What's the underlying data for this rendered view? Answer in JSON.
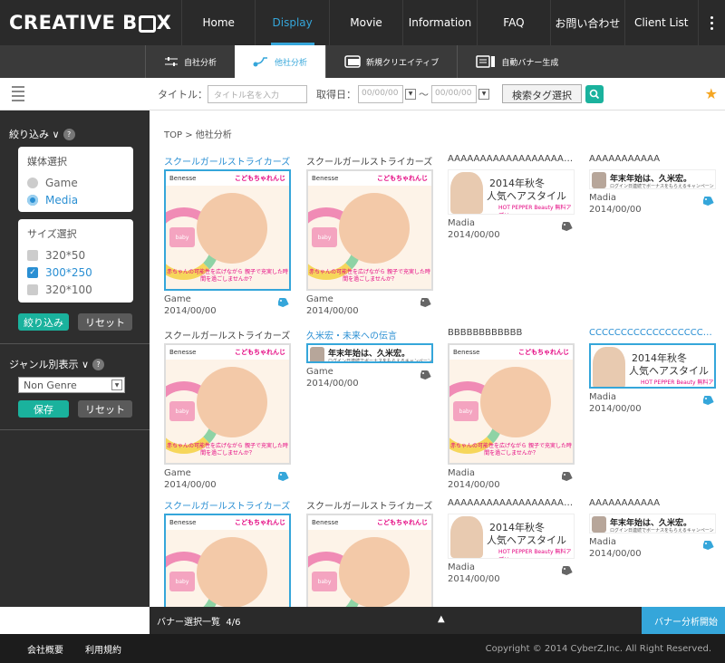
{
  "app": {
    "logo_text_1": "CREATIVE B",
    "logo_text_2": "X"
  },
  "nav": [
    {
      "label": "Home",
      "active": false
    },
    {
      "label": "Display",
      "active": true
    },
    {
      "label": "Movie",
      "active": false
    },
    {
      "label": "Information",
      "active": false
    },
    {
      "label": "FAQ",
      "active": false
    },
    {
      "label": "お問い合わせ",
      "active": false
    },
    {
      "label": "Client List",
      "active": false
    }
  ],
  "subnav": [
    {
      "label": "自社分析",
      "icon": "sliders-icon",
      "active": false
    },
    {
      "label": "他社分析",
      "icon": "analysis-icon",
      "active": true
    },
    {
      "label": "新規クリエイティブ",
      "icon": "creative-icon",
      "active": false
    },
    {
      "label": "自動バナー生成",
      "icon": "banner-icon",
      "active": false
    }
  ],
  "toolbar": {
    "title_label": "タイトル：",
    "title_placeholder": "タイトル名を入力",
    "date_label": "取得日：",
    "date_from": "00/00/00",
    "date_to": "00/00/00",
    "tilde": "～",
    "tag_button": "検索タグ選択"
  },
  "sidebar": {
    "filter_label": "絞り込み ∨",
    "media_title": "媒体選択",
    "media_options": [
      {
        "label": "Game",
        "checked": false
      },
      {
        "label": "Media",
        "checked": true
      }
    ],
    "size_title": "サイズ選択",
    "size_options": [
      {
        "label": "320*50",
        "checked": false
      },
      {
        "label": "300*250",
        "checked": true
      },
      {
        "label": "320*100",
        "checked": false
      }
    ],
    "apply_button": "絞り込み",
    "reset_button": "リセット",
    "genre_label": "ジャンル別表示 ∨",
    "genre_value": "Non Genre",
    "save_button": "保存",
    "reset_button_2": "リセット"
  },
  "breadcrumb": "TOP > 他社分析",
  "banner_text": {
    "benesse": "Benesse",
    "kodomo": "こどもちゃれんじ",
    "baby": "baby",
    "caption": "赤ちゃんの可能性を広げながら\n親子で充実した時間を過ごしませんか？",
    "autumn_line1": "2014年秋冬",
    "autumn_line2": "人気ヘアスタイル",
    "autumn_small": "HOT PEPPER Beauty 無料アプリ",
    "newyear_title": "年末年始は、久米宏。",
    "newyear_sub": "ログイン日連続でボーナスをもらえるキャンペーン"
  },
  "cards": [
    {
      "title": "スクールガールストライカーズ",
      "title_blue": true,
      "meta1": "Game",
      "meta2": "2014/00/00",
      "tag": "blue",
      "type": "sq",
      "selected": true
    },
    {
      "title": "スクールガールストライカーズ",
      "title_blue": false,
      "meta1": "Game",
      "meta2": "2014/00/00",
      "tag": "grey",
      "type": "sq",
      "selected": false
    },
    {
      "title": "AAAAAAAAAAAAAAAAAAAA···",
      "title_blue": false,
      "meta1": "Madia",
      "meta2": "2014/00/00",
      "tag": "grey",
      "type": "md",
      "selected": false
    },
    {
      "title": "AAAAAAAAAAA",
      "title_blue": false,
      "meta1": "Madia",
      "meta2": "2014/00/00",
      "tag": "blue",
      "type": "wd",
      "selected": false
    },
    {
      "title": "スクールガールストライカーズ",
      "title_blue": false,
      "meta1": "Game",
      "meta2": "2014/00/00",
      "tag": "blue",
      "type": "sq",
      "selected": false
    },
    {
      "title": "久米宏・未来への伝言",
      "title_blue": true,
      "meta1": "Game",
      "meta2": "2014/00/00",
      "tag": "grey",
      "type": "wd",
      "selected": true
    },
    {
      "title": "BBBBBBBBBBBB",
      "title_blue": false,
      "meta1": "Madia",
      "meta2": "2014/00/00",
      "tag": "grey",
      "type": "sq",
      "selected": false
    },
    {
      "title": "CCCCCCCCCCCCCCCCCCCC···",
      "title_blue": true,
      "meta1": "Madia",
      "meta2": "2014/00/00",
      "tag": "blue",
      "type": "md",
      "selected": true
    },
    {
      "title": "スクールガールストライカーズ",
      "title_blue": true,
      "meta1": "",
      "meta2": "",
      "tag": "",
      "type": "sq",
      "selected": true
    },
    {
      "title": "スクールガールストライカーズ",
      "title_blue": false,
      "meta1": "",
      "meta2": "",
      "tag": "",
      "type": "sq",
      "selected": false
    },
    {
      "title": "AAAAAAAAAAAAAAAAAAAA···",
      "title_blue": false,
      "meta1": "Madia",
      "meta2": "2014/00/00",
      "tag": "grey",
      "type": "md",
      "selected": false
    },
    {
      "title": "AAAAAAAAAAA",
      "title_blue": false,
      "meta1": "Madia",
      "meta2": "2014/00/00",
      "tag": "blue",
      "type": "wd",
      "selected": false
    }
  ],
  "bottombar": {
    "label": "バナー選択一覧",
    "count": "4/6",
    "analyze_button": "バナー分析開始"
  },
  "footer": {
    "about": "会社概要",
    "terms": "利用規約",
    "copyright": "Copyright © 2014 CyberZ,Inc. All Right Reserved."
  },
  "colors": {
    "accent": "#35a6da",
    "green": "#1ab29d",
    "star": "#f5a623"
  }
}
